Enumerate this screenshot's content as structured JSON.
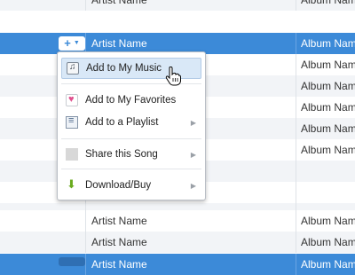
{
  "rows": [
    {
      "artist": "Artist Name",
      "album": "Album Name",
      "state": "normal"
    },
    {
      "artist": "Artist Name",
      "album": "Album Name",
      "state": "selected"
    },
    {
      "artist": "",
      "album": "Album Name",
      "state": "normal"
    },
    {
      "artist": "",
      "album": "Album Name",
      "state": "normal"
    },
    {
      "artist": "",
      "album": "Album Name",
      "state": "normal"
    },
    {
      "artist": "",
      "album": "Album Name",
      "state": "normal"
    },
    {
      "artist": "",
      "album": "Album Name",
      "state": "normal"
    },
    {
      "artist": "",
      "album": "",
      "state": "normal"
    },
    {
      "artist": "",
      "album": "",
      "state": "normal"
    },
    {
      "artist": "",
      "album": "",
      "state": "normal"
    },
    {
      "artist": "Artist Name",
      "album": "Album Name",
      "state": "normal"
    },
    {
      "artist": "Artist Name",
      "album": "Album Name",
      "state": "normal"
    },
    {
      "artist": "Artist Name",
      "album": "Album Name",
      "state": "selected"
    }
  ],
  "add_button": {
    "icon": "plus-icon",
    "caret": "chevron-down-icon"
  },
  "menu": {
    "items": [
      {
        "label": "Add to My Music",
        "icon": "music-note-icon",
        "submenu": false,
        "hover": true
      },
      {
        "label": "Add to My Favorites",
        "icon": "heart-icon",
        "submenu": false,
        "hover": false
      },
      {
        "label": "Add to a Playlist",
        "icon": "playlist-icon",
        "submenu": true,
        "hover": false
      },
      {
        "label": "Share this Song",
        "icon": "share-icon",
        "submenu": true,
        "hover": false
      },
      {
        "label": "Download/Buy",
        "icon": "download-arrow-icon",
        "submenu": true,
        "hover": false
      }
    ]
  },
  "colors": {
    "selection": "#3c8ad8",
    "stripe": "#f2f4f7",
    "menu_hover": "#d9e8f7"
  }
}
